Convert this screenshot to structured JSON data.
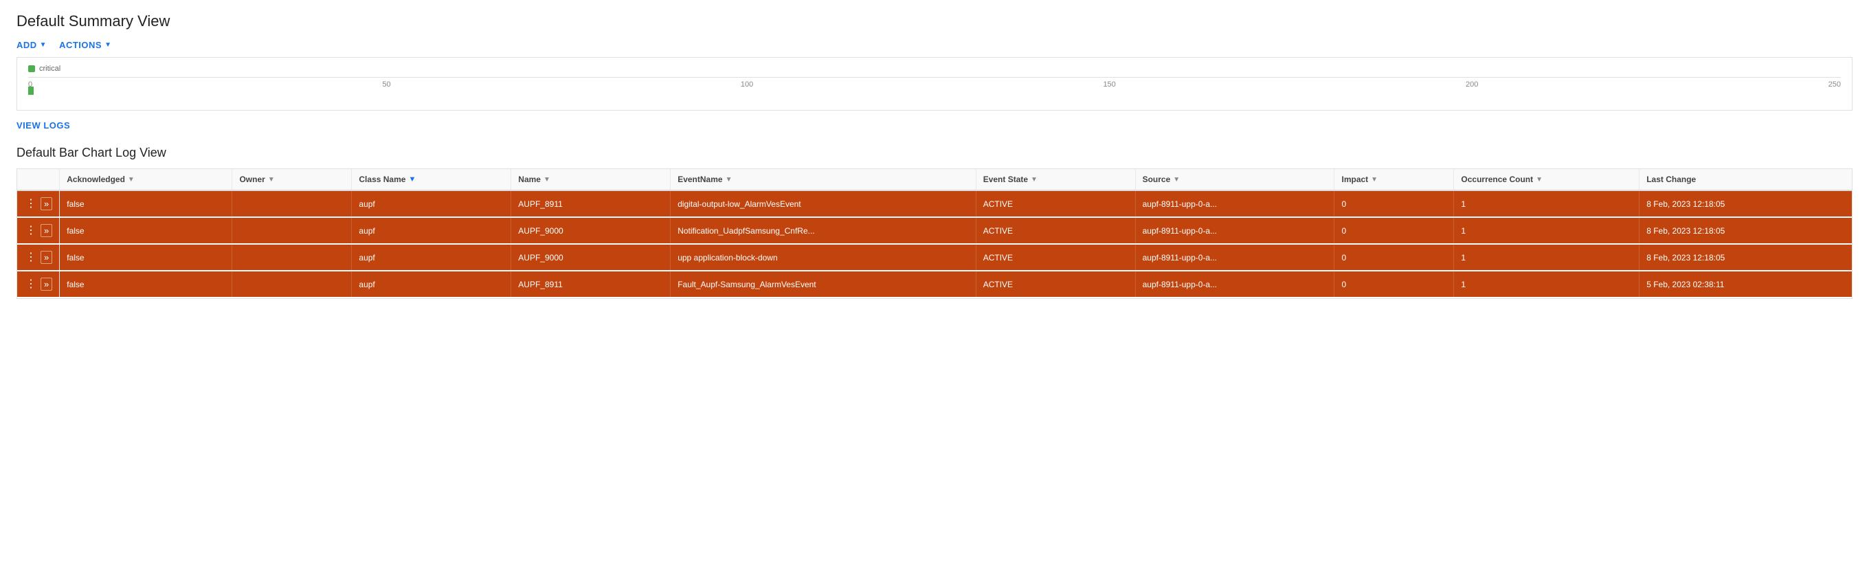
{
  "page": {
    "title": "Default Summary View",
    "section2_title": "Default Bar Chart Log View"
  },
  "toolbar": {
    "add_label": "ADD",
    "actions_label": "ACTIONS"
  },
  "view_logs": {
    "label": "VIEW LOGS"
  },
  "chart": {
    "legend_label": "critical",
    "x_labels": [
      "0",
      "50",
      "100",
      "150",
      "200",
      "250"
    ]
  },
  "table": {
    "columns": [
      {
        "id": "actions",
        "label": ""
      },
      {
        "id": "ack",
        "label": "Acknowledged",
        "filter": true,
        "filter_type": "normal"
      },
      {
        "id": "owner",
        "label": "Owner",
        "filter": true,
        "filter_type": "normal"
      },
      {
        "id": "class",
        "label": "Class Name",
        "filter": true,
        "filter_type": "blue"
      },
      {
        "id": "name",
        "label": "Name",
        "filter": true,
        "filter_type": "normal"
      },
      {
        "id": "eventname",
        "label": "EventName",
        "filter": true,
        "filter_type": "normal"
      },
      {
        "id": "state",
        "label": "Event State",
        "filter": true,
        "filter_type": "normal"
      },
      {
        "id": "source",
        "label": "Source",
        "filter": true,
        "filter_type": "normal"
      },
      {
        "id": "impact",
        "label": "Impact",
        "filter": true,
        "filter_type": "normal"
      },
      {
        "id": "occ",
        "label": "Occurrence Count",
        "filter": true,
        "filter_type": "normal"
      },
      {
        "id": "last",
        "label": "Last Change",
        "filter": false
      }
    ],
    "rows": [
      {
        "ack": "false",
        "owner": "",
        "class": "aupf",
        "name": "AUPF_8911",
        "eventname": "digital-output-low_AlarmVesEvent",
        "state": "ACTIVE",
        "source": "aupf-8911-upp-0-a...",
        "impact": "0",
        "occ": "1",
        "last": "8 Feb, 2023 12:18:05"
      },
      {
        "ack": "false",
        "owner": "",
        "class": "aupf",
        "name": "AUPF_9000",
        "eventname": "Notification_UadpfSamsung_CnfRe...",
        "state": "ACTIVE",
        "source": "aupf-8911-upp-0-a...",
        "impact": "0",
        "occ": "1",
        "last": "8 Feb, 2023 12:18:05"
      },
      {
        "ack": "false",
        "owner": "",
        "class": "aupf",
        "name": "AUPF_9000",
        "eventname": "upp application-block-down",
        "state": "ACTIVE",
        "source": "aupf-8911-upp-0-a...",
        "impact": "0",
        "occ": "1",
        "last": "8 Feb, 2023 12:18:05"
      },
      {
        "ack": "false",
        "owner": "",
        "class": "aupf",
        "name": "AUPF_8911",
        "eventname": "Fault_Aupf-Samsung_AlarmVesEvent",
        "state": "ACTIVE",
        "source": "aupf-8911-upp-0-a...",
        "impact": "0",
        "occ": "1",
        "last": "5 Feb, 2023 02:38:11"
      }
    ]
  }
}
